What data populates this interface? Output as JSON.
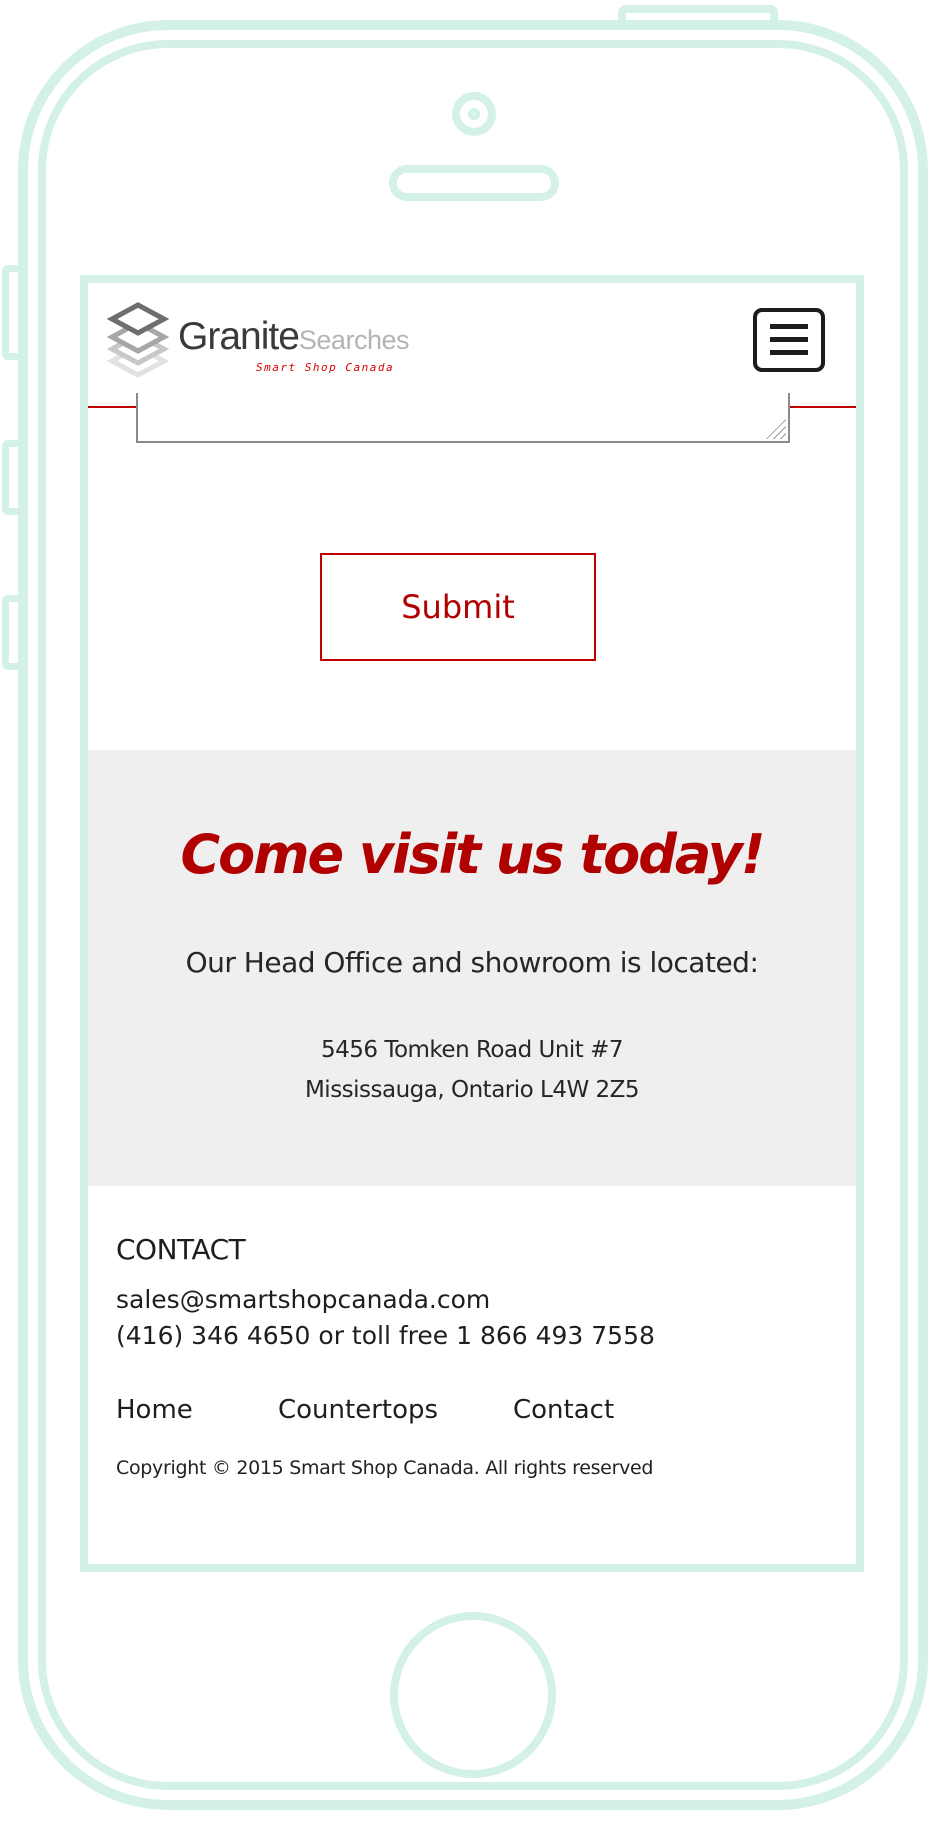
{
  "header": {
    "logo": {
      "brand_main": "Granite",
      "brand_secondary": "Searches",
      "tagline": "Smart Shop Canada",
      "icon": "stacked-layers-icon"
    },
    "menu_icon": "hamburger-menu-icon"
  },
  "form": {
    "submit_label": "Submit"
  },
  "visit": {
    "title": "Come visit us today!",
    "subtitle": "Our Head Office and showroom is located:",
    "address_line1": "5456 Tomken Road Unit #7",
    "address_line2": "Mississauga, Ontario L4W 2Z5"
  },
  "footer": {
    "contact_heading": "CONTACT",
    "email": "sales@smartshopcanada.com",
    "phone": "(416) 346 4650 or toll free 1 866 493 7558",
    "nav": [
      "Home",
      "Countertops",
      "Contact"
    ],
    "copyright": "Copyright © 2015 Smart Shop Canada. All rights reserved"
  },
  "colors": {
    "accent": "#b00000",
    "frame": "#d3f1e8",
    "section_bg": "#efefef"
  }
}
